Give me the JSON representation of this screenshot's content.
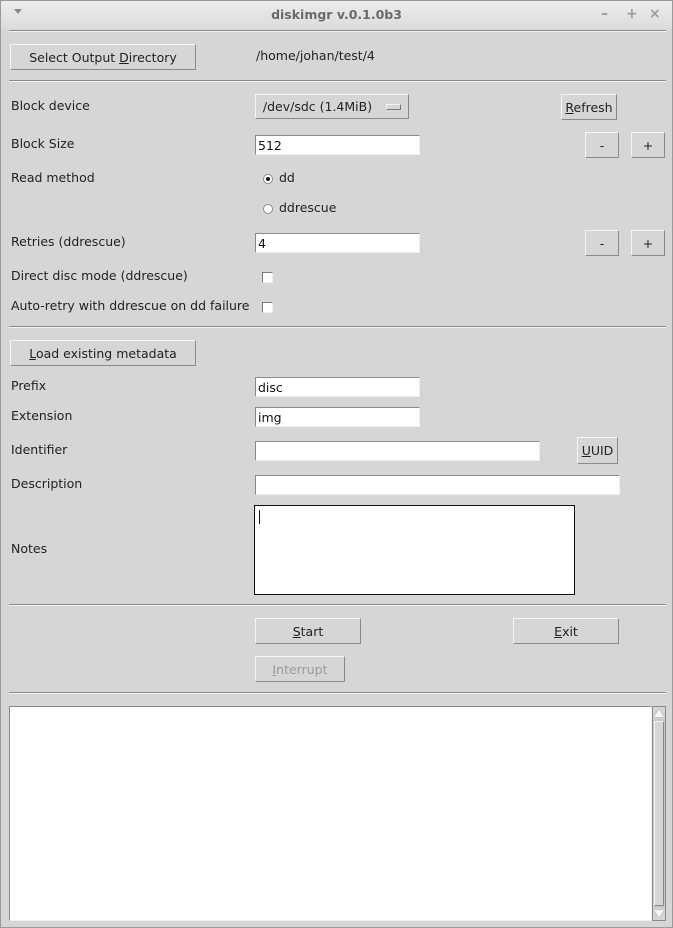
{
  "window": {
    "title": "diskimgr v.0.1.0b3",
    "controls": {
      "minimize": "–",
      "maximize": "+",
      "close": "×"
    }
  },
  "output": {
    "select_button_label": "Select Output Directory",
    "select_button_mnemonic": "D",
    "directory": "/home/johan/test/4"
  },
  "device": {
    "block_device_label": "Block device",
    "block_device_value": "/dev/sdc (1.4MiB)",
    "refresh_label": "Refresh",
    "block_size_label": "Block Size",
    "block_size_value": "512",
    "decrement_label": "-",
    "increment_label": "+",
    "read_method_label": "Read method",
    "read_methods": [
      {
        "label": "dd",
        "selected": true
      },
      {
        "label": "ddrescue",
        "selected": false
      }
    ],
    "retries_label": "Retries (ddrescue)",
    "retries_value": "4",
    "direct_disc_label": "Direct disc mode (ddrescue)",
    "direct_disc_checked": false,
    "auto_retry_label": "Auto-retry with ddrescue on dd failure",
    "auto_retry_checked": false
  },
  "metadata": {
    "load_button_label": "Load existing metadata",
    "prefix_label": "Prefix",
    "prefix_value": "disc",
    "extension_label": "Extension",
    "extension_value": "img",
    "identifier_label": "Identifier",
    "identifier_value": "",
    "uuid_label": "UUID",
    "description_label": "Description",
    "description_value": "",
    "notes_label": "Notes",
    "notes_value": ""
  },
  "actions": {
    "start_label": "Start",
    "exit_label": "Exit",
    "interrupt_label": "Interrupt",
    "interrupt_enabled": false
  },
  "log": {
    "text": ""
  }
}
